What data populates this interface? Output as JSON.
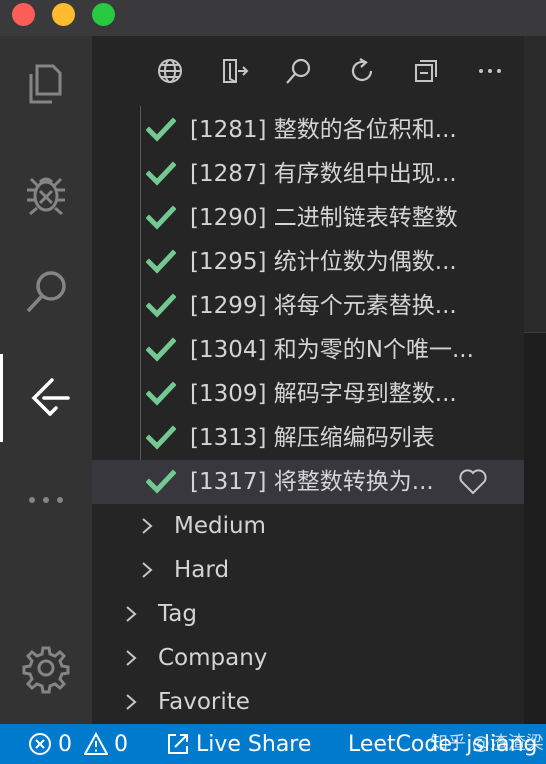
{
  "toolbar": {
    "icons": [
      "globe-icon",
      "sign-out-icon",
      "search-icon",
      "refresh-icon",
      "collapse-all-icon",
      "more-icon"
    ]
  },
  "problems": [
    {
      "label": "[1281] 整数的各位积和..."
    },
    {
      "label": "[1287] 有序数组中出现..."
    },
    {
      "label": "[1290] 二进制链表转整数"
    },
    {
      "label": "[1295] 统计位数为偶数..."
    },
    {
      "label": "[1299] 将每个元素替换..."
    },
    {
      "label": "[1304] 和为零的N个唯一..."
    },
    {
      "label": "[1309] 解码字母到整数..."
    },
    {
      "label": "[1313] 解压缩编码列表"
    },
    {
      "label": "[1317] 将整数转换为..."
    }
  ],
  "difficulty_groups": [
    {
      "label": "Medium"
    },
    {
      "label": "Hard"
    }
  ],
  "top_groups": [
    {
      "label": "Tag"
    },
    {
      "label": "Company"
    },
    {
      "label": "Favorite"
    }
  ],
  "status": {
    "errors": "0",
    "warnings": "0",
    "live_share": "Live Share",
    "leetcode": "LeetCode: jsliang",
    "watermark": "知乎 @渣渣梁"
  },
  "colors": {
    "check": "#73c991",
    "statusbar": "#007acc",
    "selected_row": "#37373d"
  }
}
